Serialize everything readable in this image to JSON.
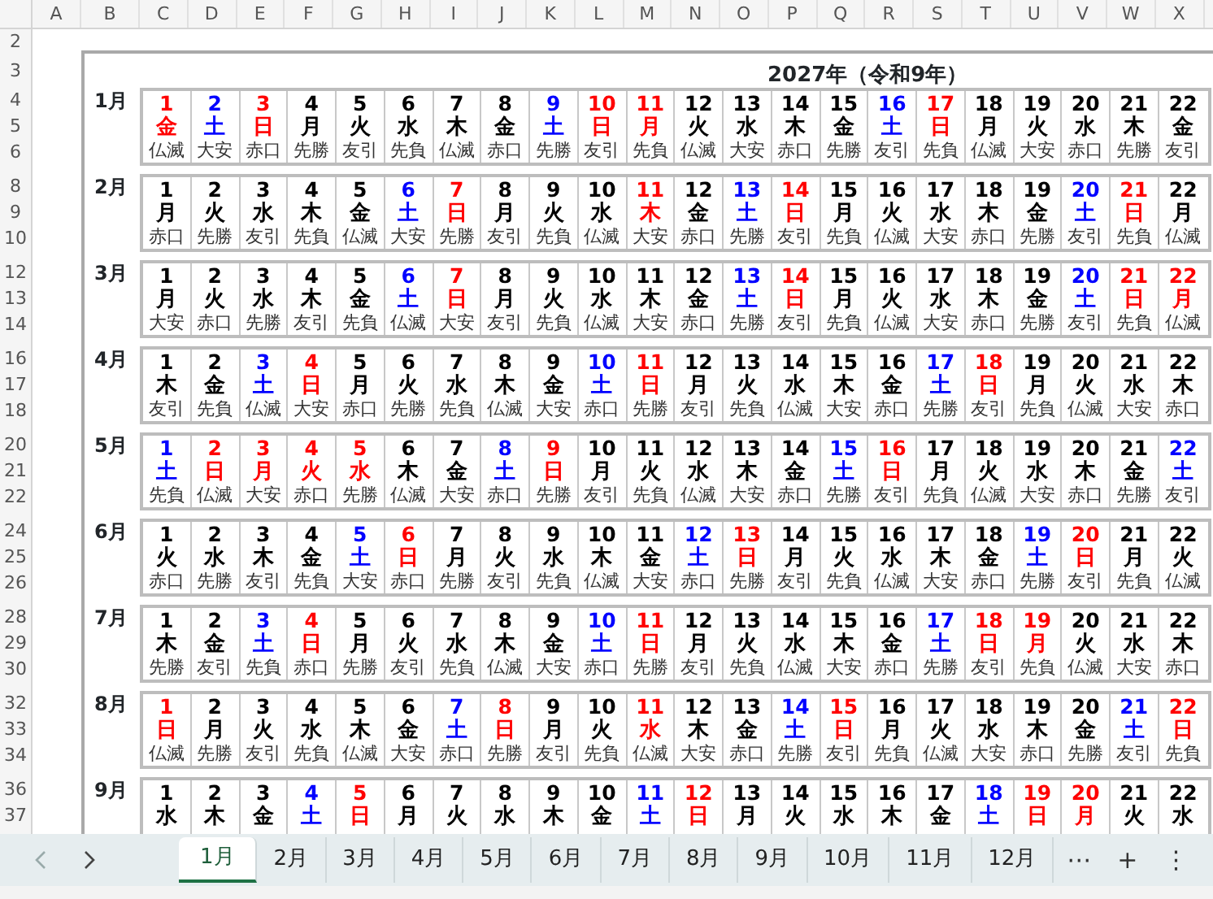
{
  "column_headers": [
    "A",
    "B",
    "C",
    "D",
    "E",
    "F",
    "G",
    "H",
    "I",
    "J",
    "K",
    "L",
    "M",
    "N",
    "O",
    "P",
    "Q",
    "R",
    "S",
    "T",
    "U",
    "V",
    "W",
    "X"
  ],
  "row_numbers": [
    "2",
    "3",
    "4",
    "5",
    "6",
    "8",
    "9",
    "10",
    "12",
    "13",
    "14",
    "16",
    "17",
    "18",
    "20",
    "21",
    "22",
    "24",
    "25",
    "26",
    "28",
    "29",
    "30",
    "32",
    "33",
    "34",
    "36",
    "37"
  ],
  "sheet": {
    "title": "2027年（令和9年）",
    "months": [
      {
        "label": "1月",
        "days": [
          {
            "day": "1",
            "weekday": "金",
            "rokuyo": "仏滅",
            "color": "#ff0000"
          },
          {
            "day": "2",
            "weekday": "土",
            "rokuyo": "大安",
            "color": "#0000ff"
          },
          {
            "day": "3",
            "weekday": "日",
            "rokuyo": "赤口",
            "color": "#ff0000"
          },
          {
            "day": "4",
            "weekday": "月",
            "rokuyo": "先勝",
            "color": "#000000"
          },
          {
            "day": "5",
            "weekday": "火",
            "rokuyo": "友引",
            "color": "#000000"
          },
          {
            "day": "6",
            "weekday": "水",
            "rokuyo": "先負",
            "color": "#000000"
          },
          {
            "day": "7",
            "weekday": "木",
            "rokuyo": "仏滅",
            "color": "#000000"
          },
          {
            "day": "8",
            "weekday": "金",
            "rokuyo": "赤口",
            "color": "#000000"
          },
          {
            "day": "9",
            "weekday": "土",
            "rokuyo": "先勝",
            "color": "#0000ff"
          },
          {
            "day": "10",
            "weekday": "日",
            "rokuyo": "友引",
            "color": "#ff0000"
          },
          {
            "day": "11",
            "weekday": "月",
            "rokuyo": "先負",
            "color": "#ff0000"
          },
          {
            "day": "12",
            "weekday": "火",
            "rokuyo": "仏滅",
            "color": "#000000"
          },
          {
            "day": "13",
            "weekday": "水",
            "rokuyo": "大安",
            "color": "#000000"
          },
          {
            "day": "14",
            "weekday": "木",
            "rokuyo": "赤口",
            "color": "#000000"
          },
          {
            "day": "15",
            "weekday": "金",
            "rokuyo": "先勝",
            "color": "#000000"
          },
          {
            "day": "16",
            "weekday": "土",
            "rokuyo": "友引",
            "color": "#0000ff"
          },
          {
            "day": "17",
            "weekday": "日",
            "rokuyo": "先負",
            "color": "#ff0000"
          },
          {
            "day": "18",
            "weekday": "月",
            "rokuyo": "仏滅",
            "color": "#000000"
          },
          {
            "day": "19",
            "weekday": "火",
            "rokuyo": "大安",
            "color": "#000000"
          },
          {
            "day": "20",
            "weekday": "水",
            "rokuyo": "赤口",
            "color": "#000000"
          },
          {
            "day": "21",
            "weekday": "木",
            "rokuyo": "先勝",
            "color": "#000000"
          },
          {
            "day": "22",
            "weekday": "金",
            "rokuyo": "友引",
            "color": "#000000"
          }
        ]
      },
      {
        "label": "2月",
        "days": [
          {
            "day": "1",
            "weekday": "月",
            "rokuyo": "赤口",
            "color": "#000000"
          },
          {
            "day": "2",
            "weekday": "火",
            "rokuyo": "先勝",
            "color": "#000000"
          },
          {
            "day": "3",
            "weekday": "水",
            "rokuyo": "友引",
            "color": "#000000"
          },
          {
            "day": "4",
            "weekday": "木",
            "rokuyo": "先負",
            "color": "#000000"
          },
          {
            "day": "5",
            "weekday": "金",
            "rokuyo": "仏滅",
            "color": "#000000"
          },
          {
            "day": "6",
            "weekday": "土",
            "rokuyo": "大安",
            "color": "#0000ff"
          },
          {
            "day": "7",
            "weekday": "日",
            "rokuyo": "先勝",
            "color": "#ff0000"
          },
          {
            "day": "8",
            "weekday": "月",
            "rokuyo": "友引",
            "color": "#000000"
          },
          {
            "day": "9",
            "weekday": "火",
            "rokuyo": "先負",
            "color": "#000000"
          },
          {
            "day": "10",
            "weekday": "水",
            "rokuyo": "仏滅",
            "color": "#000000"
          },
          {
            "day": "11",
            "weekday": "木",
            "rokuyo": "大安",
            "color": "#ff0000"
          },
          {
            "day": "12",
            "weekday": "金",
            "rokuyo": "赤口",
            "color": "#000000"
          },
          {
            "day": "13",
            "weekday": "土",
            "rokuyo": "先勝",
            "color": "#0000ff"
          },
          {
            "day": "14",
            "weekday": "日",
            "rokuyo": "友引",
            "color": "#ff0000"
          },
          {
            "day": "15",
            "weekday": "月",
            "rokuyo": "先負",
            "color": "#000000"
          },
          {
            "day": "16",
            "weekday": "火",
            "rokuyo": "仏滅",
            "color": "#000000"
          },
          {
            "day": "17",
            "weekday": "水",
            "rokuyo": "大安",
            "color": "#000000"
          },
          {
            "day": "18",
            "weekday": "木",
            "rokuyo": "赤口",
            "color": "#000000"
          },
          {
            "day": "19",
            "weekday": "金",
            "rokuyo": "先勝",
            "color": "#000000"
          },
          {
            "day": "20",
            "weekday": "土",
            "rokuyo": "友引",
            "color": "#0000ff"
          },
          {
            "day": "21",
            "weekday": "日",
            "rokuyo": "先負",
            "color": "#ff0000"
          },
          {
            "day": "22",
            "weekday": "月",
            "rokuyo": "仏滅",
            "color": "#000000"
          }
        ]
      },
      {
        "label": "3月",
        "days": [
          {
            "day": "1",
            "weekday": "月",
            "rokuyo": "大安",
            "color": "#000000"
          },
          {
            "day": "2",
            "weekday": "火",
            "rokuyo": "赤口",
            "color": "#000000"
          },
          {
            "day": "3",
            "weekday": "水",
            "rokuyo": "先勝",
            "color": "#000000"
          },
          {
            "day": "4",
            "weekday": "木",
            "rokuyo": "友引",
            "color": "#000000"
          },
          {
            "day": "5",
            "weekday": "金",
            "rokuyo": "先負",
            "color": "#000000"
          },
          {
            "day": "6",
            "weekday": "土",
            "rokuyo": "仏滅",
            "color": "#0000ff"
          },
          {
            "day": "7",
            "weekday": "日",
            "rokuyo": "大安",
            "color": "#ff0000"
          },
          {
            "day": "8",
            "weekday": "月",
            "rokuyo": "友引",
            "color": "#000000"
          },
          {
            "day": "9",
            "weekday": "火",
            "rokuyo": "先負",
            "color": "#000000"
          },
          {
            "day": "10",
            "weekday": "水",
            "rokuyo": "仏滅",
            "color": "#000000"
          },
          {
            "day": "11",
            "weekday": "木",
            "rokuyo": "大安",
            "color": "#000000"
          },
          {
            "day": "12",
            "weekday": "金",
            "rokuyo": "赤口",
            "color": "#000000"
          },
          {
            "day": "13",
            "weekday": "土",
            "rokuyo": "先勝",
            "color": "#0000ff"
          },
          {
            "day": "14",
            "weekday": "日",
            "rokuyo": "友引",
            "color": "#ff0000"
          },
          {
            "day": "15",
            "weekday": "月",
            "rokuyo": "先負",
            "color": "#000000"
          },
          {
            "day": "16",
            "weekday": "火",
            "rokuyo": "仏滅",
            "color": "#000000"
          },
          {
            "day": "17",
            "weekday": "水",
            "rokuyo": "大安",
            "color": "#000000"
          },
          {
            "day": "18",
            "weekday": "木",
            "rokuyo": "赤口",
            "color": "#000000"
          },
          {
            "day": "19",
            "weekday": "金",
            "rokuyo": "先勝",
            "color": "#000000"
          },
          {
            "day": "20",
            "weekday": "土",
            "rokuyo": "友引",
            "color": "#0000ff"
          },
          {
            "day": "21",
            "weekday": "日",
            "rokuyo": "先負",
            "color": "#ff0000"
          },
          {
            "day": "22",
            "weekday": "月",
            "rokuyo": "仏滅",
            "color": "#ff0000"
          }
        ]
      },
      {
        "label": "4月",
        "days": [
          {
            "day": "1",
            "weekday": "木",
            "rokuyo": "友引",
            "color": "#000000"
          },
          {
            "day": "2",
            "weekday": "金",
            "rokuyo": "先負",
            "color": "#000000"
          },
          {
            "day": "3",
            "weekday": "土",
            "rokuyo": "仏滅",
            "color": "#0000ff"
          },
          {
            "day": "4",
            "weekday": "日",
            "rokuyo": "大安",
            "color": "#ff0000"
          },
          {
            "day": "5",
            "weekday": "月",
            "rokuyo": "赤口",
            "color": "#000000"
          },
          {
            "day": "6",
            "weekday": "火",
            "rokuyo": "先勝",
            "color": "#000000"
          },
          {
            "day": "7",
            "weekday": "水",
            "rokuyo": "先負",
            "color": "#000000"
          },
          {
            "day": "8",
            "weekday": "木",
            "rokuyo": "仏滅",
            "color": "#000000"
          },
          {
            "day": "9",
            "weekday": "金",
            "rokuyo": "大安",
            "color": "#000000"
          },
          {
            "day": "10",
            "weekday": "土",
            "rokuyo": "赤口",
            "color": "#0000ff"
          },
          {
            "day": "11",
            "weekday": "日",
            "rokuyo": "先勝",
            "color": "#ff0000"
          },
          {
            "day": "12",
            "weekday": "月",
            "rokuyo": "友引",
            "color": "#000000"
          },
          {
            "day": "13",
            "weekday": "火",
            "rokuyo": "先負",
            "color": "#000000"
          },
          {
            "day": "14",
            "weekday": "水",
            "rokuyo": "仏滅",
            "color": "#000000"
          },
          {
            "day": "15",
            "weekday": "木",
            "rokuyo": "大安",
            "color": "#000000"
          },
          {
            "day": "16",
            "weekday": "金",
            "rokuyo": "赤口",
            "color": "#000000"
          },
          {
            "day": "17",
            "weekday": "土",
            "rokuyo": "先勝",
            "color": "#0000ff"
          },
          {
            "day": "18",
            "weekday": "日",
            "rokuyo": "友引",
            "color": "#ff0000"
          },
          {
            "day": "19",
            "weekday": "月",
            "rokuyo": "先負",
            "color": "#000000"
          },
          {
            "day": "20",
            "weekday": "火",
            "rokuyo": "仏滅",
            "color": "#000000"
          },
          {
            "day": "21",
            "weekday": "水",
            "rokuyo": "大安",
            "color": "#000000"
          },
          {
            "day": "22",
            "weekday": "木",
            "rokuyo": "赤口",
            "color": "#000000"
          }
        ]
      },
      {
        "label": "5月",
        "days": [
          {
            "day": "1",
            "weekday": "土",
            "rokuyo": "先負",
            "color": "#0000ff"
          },
          {
            "day": "2",
            "weekday": "日",
            "rokuyo": "仏滅",
            "color": "#ff0000"
          },
          {
            "day": "3",
            "weekday": "月",
            "rokuyo": "大安",
            "color": "#ff0000"
          },
          {
            "day": "4",
            "weekday": "火",
            "rokuyo": "赤口",
            "color": "#ff0000"
          },
          {
            "day": "5",
            "weekday": "水",
            "rokuyo": "先勝",
            "color": "#ff0000"
          },
          {
            "day": "6",
            "weekday": "木",
            "rokuyo": "仏滅",
            "color": "#000000"
          },
          {
            "day": "7",
            "weekday": "金",
            "rokuyo": "大安",
            "color": "#000000"
          },
          {
            "day": "8",
            "weekday": "土",
            "rokuyo": "赤口",
            "color": "#0000ff"
          },
          {
            "day": "9",
            "weekday": "日",
            "rokuyo": "先勝",
            "color": "#ff0000"
          },
          {
            "day": "10",
            "weekday": "月",
            "rokuyo": "友引",
            "color": "#000000"
          },
          {
            "day": "11",
            "weekday": "火",
            "rokuyo": "先負",
            "color": "#000000"
          },
          {
            "day": "12",
            "weekday": "水",
            "rokuyo": "仏滅",
            "color": "#000000"
          },
          {
            "day": "13",
            "weekday": "木",
            "rokuyo": "大安",
            "color": "#000000"
          },
          {
            "day": "14",
            "weekday": "金",
            "rokuyo": "赤口",
            "color": "#000000"
          },
          {
            "day": "15",
            "weekday": "土",
            "rokuyo": "先勝",
            "color": "#0000ff"
          },
          {
            "day": "16",
            "weekday": "日",
            "rokuyo": "友引",
            "color": "#ff0000"
          },
          {
            "day": "17",
            "weekday": "月",
            "rokuyo": "先負",
            "color": "#000000"
          },
          {
            "day": "18",
            "weekday": "火",
            "rokuyo": "仏滅",
            "color": "#000000"
          },
          {
            "day": "19",
            "weekday": "水",
            "rokuyo": "大安",
            "color": "#000000"
          },
          {
            "day": "20",
            "weekday": "木",
            "rokuyo": "赤口",
            "color": "#000000"
          },
          {
            "day": "21",
            "weekday": "金",
            "rokuyo": "先勝",
            "color": "#000000"
          },
          {
            "day": "22",
            "weekday": "土",
            "rokuyo": "友引",
            "color": "#0000ff"
          }
        ]
      },
      {
        "label": "6月",
        "days": [
          {
            "day": "1",
            "weekday": "火",
            "rokuyo": "赤口",
            "color": "#000000"
          },
          {
            "day": "2",
            "weekday": "水",
            "rokuyo": "先勝",
            "color": "#000000"
          },
          {
            "day": "3",
            "weekday": "木",
            "rokuyo": "友引",
            "color": "#000000"
          },
          {
            "day": "4",
            "weekday": "金",
            "rokuyo": "先負",
            "color": "#000000"
          },
          {
            "day": "5",
            "weekday": "土",
            "rokuyo": "大安",
            "color": "#0000ff"
          },
          {
            "day": "6",
            "weekday": "日",
            "rokuyo": "赤口",
            "color": "#ff0000"
          },
          {
            "day": "7",
            "weekday": "月",
            "rokuyo": "先勝",
            "color": "#000000"
          },
          {
            "day": "8",
            "weekday": "火",
            "rokuyo": "友引",
            "color": "#000000"
          },
          {
            "day": "9",
            "weekday": "水",
            "rokuyo": "先負",
            "color": "#000000"
          },
          {
            "day": "10",
            "weekday": "木",
            "rokuyo": "仏滅",
            "color": "#000000"
          },
          {
            "day": "11",
            "weekday": "金",
            "rokuyo": "大安",
            "color": "#000000"
          },
          {
            "day": "12",
            "weekday": "土",
            "rokuyo": "赤口",
            "color": "#0000ff"
          },
          {
            "day": "13",
            "weekday": "日",
            "rokuyo": "先勝",
            "color": "#ff0000"
          },
          {
            "day": "14",
            "weekday": "月",
            "rokuyo": "友引",
            "color": "#000000"
          },
          {
            "day": "15",
            "weekday": "火",
            "rokuyo": "先負",
            "color": "#000000"
          },
          {
            "day": "16",
            "weekday": "水",
            "rokuyo": "仏滅",
            "color": "#000000"
          },
          {
            "day": "17",
            "weekday": "木",
            "rokuyo": "大安",
            "color": "#000000"
          },
          {
            "day": "18",
            "weekday": "金",
            "rokuyo": "赤口",
            "color": "#000000"
          },
          {
            "day": "19",
            "weekday": "土",
            "rokuyo": "先勝",
            "color": "#0000ff"
          },
          {
            "day": "20",
            "weekday": "日",
            "rokuyo": "友引",
            "color": "#ff0000"
          },
          {
            "day": "21",
            "weekday": "月",
            "rokuyo": "先負",
            "color": "#000000"
          },
          {
            "day": "22",
            "weekday": "火",
            "rokuyo": "仏滅",
            "color": "#000000"
          }
        ]
      },
      {
        "label": "7月",
        "days": [
          {
            "day": "1",
            "weekday": "木",
            "rokuyo": "先勝",
            "color": "#000000"
          },
          {
            "day": "2",
            "weekday": "金",
            "rokuyo": "友引",
            "color": "#000000"
          },
          {
            "day": "3",
            "weekday": "土",
            "rokuyo": "先負",
            "color": "#0000ff"
          },
          {
            "day": "4",
            "weekday": "日",
            "rokuyo": "赤口",
            "color": "#ff0000"
          },
          {
            "day": "5",
            "weekday": "月",
            "rokuyo": "先勝",
            "color": "#000000"
          },
          {
            "day": "6",
            "weekday": "火",
            "rokuyo": "友引",
            "color": "#000000"
          },
          {
            "day": "7",
            "weekday": "水",
            "rokuyo": "先負",
            "color": "#000000"
          },
          {
            "day": "8",
            "weekday": "木",
            "rokuyo": "仏滅",
            "color": "#000000"
          },
          {
            "day": "9",
            "weekday": "金",
            "rokuyo": "大安",
            "color": "#000000"
          },
          {
            "day": "10",
            "weekday": "土",
            "rokuyo": "赤口",
            "color": "#0000ff"
          },
          {
            "day": "11",
            "weekday": "日",
            "rokuyo": "先勝",
            "color": "#ff0000"
          },
          {
            "day": "12",
            "weekday": "月",
            "rokuyo": "友引",
            "color": "#000000"
          },
          {
            "day": "13",
            "weekday": "火",
            "rokuyo": "先負",
            "color": "#000000"
          },
          {
            "day": "14",
            "weekday": "水",
            "rokuyo": "仏滅",
            "color": "#000000"
          },
          {
            "day": "15",
            "weekday": "木",
            "rokuyo": "大安",
            "color": "#000000"
          },
          {
            "day": "16",
            "weekday": "金",
            "rokuyo": "赤口",
            "color": "#000000"
          },
          {
            "day": "17",
            "weekday": "土",
            "rokuyo": "先勝",
            "color": "#0000ff"
          },
          {
            "day": "18",
            "weekday": "日",
            "rokuyo": "友引",
            "color": "#ff0000"
          },
          {
            "day": "19",
            "weekday": "月",
            "rokuyo": "先負",
            "color": "#ff0000"
          },
          {
            "day": "20",
            "weekday": "火",
            "rokuyo": "仏滅",
            "color": "#000000"
          },
          {
            "day": "21",
            "weekday": "水",
            "rokuyo": "大安",
            "color": "#000000"
          },
          {
            "day": "22",
            "weekday": "木",
            "rokuyo": "赤口",
            "color": "#000000"
          }
        ]
      },
      {
        "label": "8月",
        "days": [
          {
            "day": "1",
            "weekday": "日",
            "rokuyo": "仏滅",
            "color": "#ff0000"
          },
          {
            "day": "2",
            "weekday": "月",
            "rokuyo": "先勝",
            "color": "#000000"
          },
          {
            "day": "3",
            "weekday": "火",
            "rokuyo": "友引",
            "color": "#000000"
          },
          {
            "day": "4",
            "weekday": "水",
            "rokuyo": "先負",
            "color": "#000000"
          },
          {
            "day": "5",
            "weekday": "木",
            "rokuyo": "仏滅",
            "color": "#000000"
          },
          {
            "day": "6",
            "weekday": "金",
            "rokuyo": "大安",
            "color": "#000000"
          },
          {
            "day": "7",
            "weekday": "土",
            "rokuyo": "赤口",
            "color": "#0000ff"
          },
          {
            "day": "8",
            "weekday": "日",
            "rokuyo": "先勝",
            "color": "#ff0000"
          },
          {
            "day": "9",
            "weekday": "月",
            "rokuyo": "友引",
            "color": "#000000"
          },
          {
            "day": "10",
            "weekday": "火",
            "rokuyo": "先負",
            "color": "#000000"
          },
          {
            "day": "11",
            "weekday": "水",
            "rokuyo": "仏滅",
            "color": "#ff0000"
          },
          {
            "day": "12",
            "weekday": "木",
            "rokuyo": "大安",
            "color": "#000000"
          },
          {
            "day": "13",
            "weekday": "金",
            "rokuyo": "赤口",
            "color": "#000000"
          },
          {
            "day": "14",
            "weekday": "土",
            "rokuyo": "先勝",
            "color": "#0000ff"
          },
          {
            "day": "15",
            "weekday": "日",
            "rokuyo": "友引",
            "color": "#ff0000"
          },
          {
            "day": "16",
            "weekday": "月",
            "rokuyo": "先負",
            "color": "#000000"
          },
          {
            "day": "17",
            "weekday": "火",
            "rokuyo": "仏滅",
            "color": "#000000"
          },
          {
            "day": "18",
            "weekday": "水",
            "rokuyo": "大安",
            "color": "#000000"
          },
          {
            "day": "19",
            "weekday": "木",
            "rokuyo": "赤口",
            "color": "#000000"
          },
          {
            "day": "20",
            "weekday": "金",
            "rokuyo": "先勝",
            "color": "#000000"
          },
          {
            "day": "21",
            "weekday": "土",
            "rokuyo": "友引",
            "color": "#0000ff"
          },
          {
            "day": "22",
            "weekday": "日",
            "rokuyo": "先負",
            "color": "#ff0000"
          }
        ]
      },
      {
        "label": "9月",
        "days": [
          {
            "day": "1",
            "weekday": "水",
            "color": "#000000"
          },
          {
            "day": "2",
            "weekday": "木",
            "color": "#000000"
          },
          {
            "day": "3",
            "weekday": "金",
            "color": "#000000"
          },
          {
            "day": "4",
            "weekday": "土",
            "color": "#0000ff"
          },
          {
            "day": "5",
            "weekday": "日",
            "color": "#ff0000"
          },
          {
            "day": "6",
            "weekday": "月",
            "color": "#000000"
          },
          {
            "day": "7",
            "weekday": "火",
            "color": "#000000"
          },
          {
            "day": "8",
            "weekday": "水",
            "color": "#000000"
          },
          {
            "day": "9",
            "weekday": "木",
            "color": "#000000"
          },
          {
            "day": "10",
            "weekday": "金",
            "color": "#000000"
          },
          {
            "day": "11",
            "weekday": "土",
            "color": "#0000ff"
          },
          {
            "day": "12",
            "weekday": "日",
            "color": "#ff0000"
          },
          {
            "day": "13",
            "weekday": "月",
            "color": "#000000"
          },
          {
            "day": "14",
            "weekday": "火",
            "color": "#000000"
          },
          {
            "day": "15",
            "weekday": "水",
            "color": "#000000"
          },
          {
            "day": "16",
            "weekday": "木",
            "color": "#000000"
          },
          {
            "day": "17",
            "weekday": "金",
            "color": "#000000"
          },
          {
            "day": "18",
            "weekday": "土",
            "color": "#0000ff"
          },
          {
            "day": "19",
            "weekday": "日",
            "color": "#ff0000"
          },
          {
            "day": "20",
            "weekday": "月",
            "color": "#ff0000"
          },
          {
            "day": "21",
            "weekday": "火",
            "color": "#000000"
          },
          {
            "day": "22",
            "weekday": "水",
            "color": "#000000"
          }
        ]
      }
    ]
  },
  "sheet_tabs": {
    "tabs": [
      {
        "label": "1月",
        "selected": true
      },
      {
        "label": "2月",
        "selected": false
      },
      {
        "label": "3月",
        "selected": false
      },
      {
        "label": "4月",
        "selected": false
      },
      {
        "label": "5月",
        "selected": false
      },
      {
        "label": "6月",
        "selected": false
      },
      {
        "label": "7月",
        "selected": false
      },
      {
        "label": "8月",
        "selected": false
      },
      {
        "label": "9月",
        "selected": false
      },
      {
        "label": "10月",
        "selected": false
      },
      {
        "label": "11月",
        "selected": false
      },
      {
        "label": "12月",
        "selected": false
      }
    ],
    "more": "⋯",
    "add": "+",
    "options": "⋮"
  }
}
